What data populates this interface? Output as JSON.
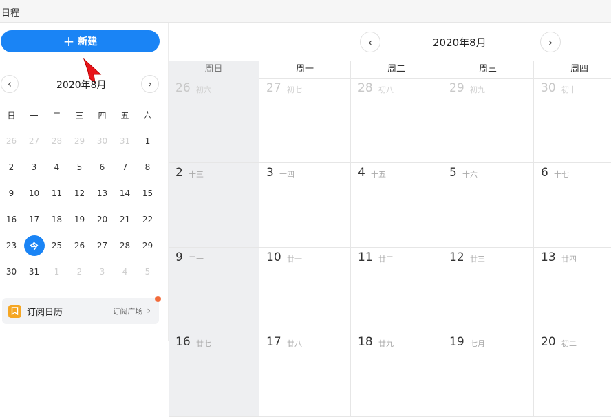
{
  "window": {
    "title": "日程"
  },
  "sidebar": {
    "new_button": {
      "icon": "plus-icon",
      "label": "新建"
    },
    "mini_calendar": {
      "title": "2020年8月",
      "weekdays": [
        "日",
        "一",
        "二",
        "三",
        "四",
        "五",
        "六"
      ],
      "days": [
        {
          "d": "26",
          "m": true
        },
        {
          "d": "27",
          "m": true
        },
        {
          "d": "28",
          "m": true
        },
        {
          "d": "29",
          "m": true
        },
        {
          "d": "30",
          "m": true
        },
        {
          "d": "31",
          "m": true
        },
        {
          "d": "1"
        },
        {
          "d": "2"
        },
        {
          "d": "3"
        },
        {
          "d": "4"
        },
        {
          "d": "5"
        },
        {
          "d": "6"
        },
        {
          "d": "7"
        },
        {
          "d": "8"
        },
        {
          "d": "9"
        },
        {
          "d": "10"
        },
        {
          "d": "11"
        },
        {
          "d": "12"
        },
        {
          "d": "13"
        },
        {
          "d": "14"
        },
        {
          "d": "15"
        },
        {
          "d": "16"
        },
        {
          "d": "17"
        },
        {
          "d": "18"
        },
        {
          "d": "19"
        },
        {
          "d": "20"
        },
        {
          "d": "21"
        },
        {
          "d": "22"
        },
        {
          "d": "23"
        },
        {
          "d": "今",
          "today": true
        },
        {
          "d": "25"
        },
        {
          "d": "26"
        },
        {
          "d": "27"
        },
        {
          "d": "28"
        },
        {
          "d": "29"
        },
        {
          "d": "30"
        },
        {
          "d": "31"
        },
        {
          "d": "1",
          "m": true
        },
        {
          "d": "2",
          "m": true
        },
        {
          "d": "3",
          "m": true
        },
        {
          "d": "4",
          "m": true
        },
        {
          "d": "5",
          "m": true
        }
      ]
    },
    "subscribe": {
      "label": "订阅日历",
      "link": "订阅广场"
    }
  },
  "main": {
    "title": "2020年8月",
    "weekdays": [
      "周日",
      "周一",
      "周二",
      "周三",
      "周四"
    ],
    "weeks": [
      [
        {
          "d": "26",
          "l": "初六",
          "m": true
        },
        {
          "d": "27",
          "l": "初七",
          "m": true
        },
        {
          "d": "28",
          "l": "初八",
          "m": true
        },
        {
          "d": "29",
          "l": "初九",
          "m": true
        },
        {
          "d": "30",
          "l": "初十",
          "m": true
        }
      ],
      [
        {
          "d": "2",
          "l": "十三"
        },
        {
          "d": "3",
          "l": "十四"
        },
        {
          "d": "4",
          "l": "十五"
        },
        {
          "d": "5",
          "l": "十六"
        },
        {
          "d": "6",
          "l": "十七"
        }
      ],
      [
        {
          "d": "9",
          "l": "二十"
        },
        {
          "d": "10",
          "l": "廿一"
        },
        {
          "d": "11",
          "l": "廿二"
        },
        {
          "d": "12",
          "l": "廿三"
        },
        {
          "d": "13",
          "l": "廿四"
        }
      ],
      [
        {
          "d": "16",
          "l": "廿七"
        },
        {
          "d": "17",
          "l": "廿八"
        },
        {
          "d": "18",
          "l": "廿九"
        },
        {
          "d": "19",
          "l": "七月"
        },
        {
          "d": "20",
          "l": "初二"
        }
      ]
    ]
  },
  "colors": {
    "accent": "#1a84f5",
    "badge": "#f26b3a",
    "subscribe_icon": "#f5a623",
    "weekend_bg": "#eeeff1"
  }
}
